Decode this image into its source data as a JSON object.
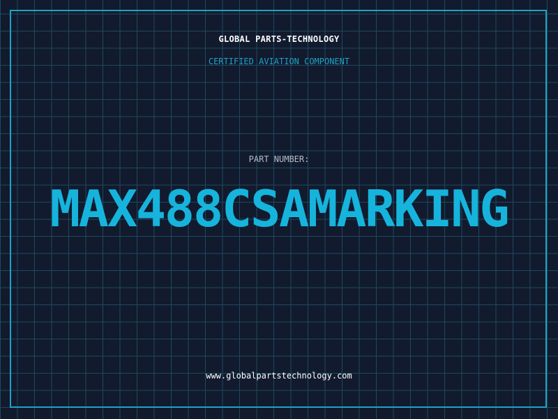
{
  "header": {
    "company_name": "GLOBAL PARTS-TECHNOLOGY",
    "tagline": "CERTIFIED AVIATION COMPONENT"
  },
  "part": {
    "label": "PART NUMBER:",
    "number": "MAX488CSAMARKING"
  },
  "footer": {
    "website": "www.globalpartstechnology.com"
  },
  "colors": {
    "background": "#121a2e",
    "grid": "#1d4a5e",
    "accent": "#1fa2c4",
    "part_number": "#16b4dc"
  }
}
